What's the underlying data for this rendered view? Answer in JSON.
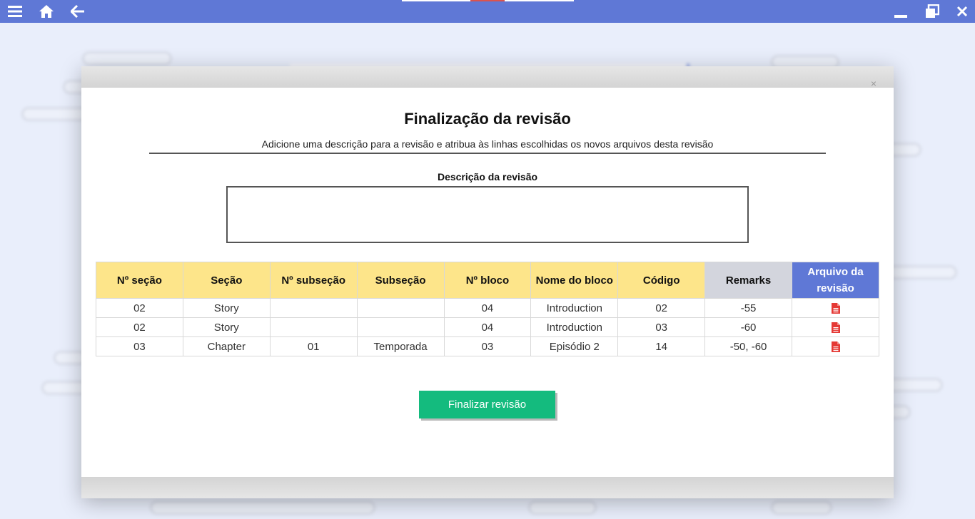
{
  "colors": {
    "accent": "#5f78d6",
    "header_yellow": "#fde58a",
    "remarks_gray": "#d3d5dd",
    "finalize_green": "#14bb7e",
    "pdf_red": "#e53935"
  },
  "topbar": {
    "icons": [
      "menu-icon",
      "home-icon",
      "back-arrow-icon",
      "minimize-icon",
      "restore-icon",
      "close-icon"
    ]
  },
  "modal": {
    "close_glyph": "×",
    "title": "Finalização da revisão",
    "subtitle": "Adicione uma descrição para a revisão e atribua às linhas escolhidas os novos arquivos desta revisão",
    "description_label": "Descrição da revisão",
    "description_value": "",
    "table": {
      "columns": [
        "Nº seção",
        "Seção",
        "Nº subseção",
        "Subseção",
        "Nº bloco",
        "Nome do bloco",
        "Código",
        "Remarks",
        "Arquivo da revisão"
      ],
      "rows": [
        {
          "secao_num": "02",
          "secao": "Story",
          "subsecao_num": "",
          "subsecao": "",
          "bloco_num": "04",
          "bloco_nome": "Introduction",
          "codigo": "02",
          "remarks": "-55",
          "arquivo_icon": "pdf-file-icon"
        },
        {
          "secao_num": "02",
          "secao": "Story",
          "subsecao_num": "",
          "subsecao": "",
          "bloco_num": "04",
          "bloco_nome": "Introduction",
          "codigo": "03",
          "remarks": "-60",
          "arquivo_icon": "pdf-file-icon"
        },
        {
          "secao_num": "03",
          "secao": "Chapter",
          "subsecao_num": "01",
          "subsecao": "Temporada",
          "bloco_num": "03",
          "bloco_nome": "Episódio 2",
          "codigo": "14",
          "remarks": "-50, -60",
          "arquivo_icon": "pdf-file-icon"
        }
      ]
    },
    "finalize_button": "Finalizar revisão"
  }
}
